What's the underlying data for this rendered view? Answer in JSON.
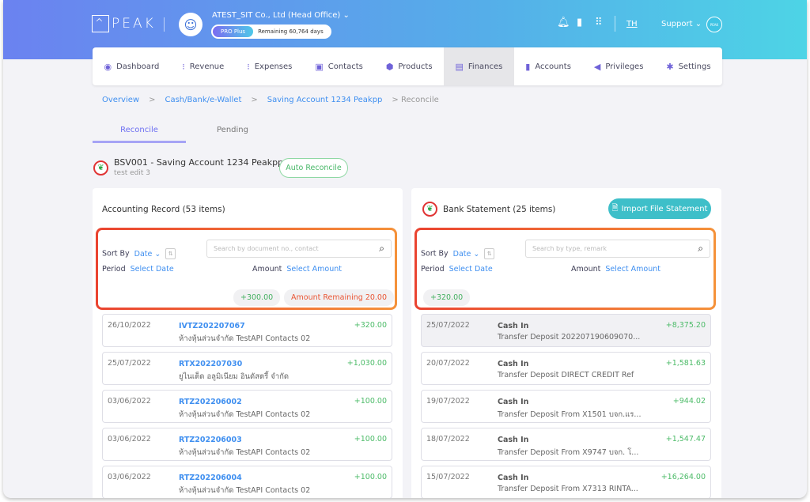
{
  "header": {
    "logo": "PEAK",
    "company": "ATEST_SIT Co., Ltd (Head Office)",
    "plan": "PRO Plus",
    "remaining": "Remaining 60,764 days",
    "lang": "TH",
    "support": "Support",
    "badge": "PEAK"
  },
  "nav": [
    {
      "label": "Dashboard",
      "icon": "◉"
    },
    {
      "label": "Revenue",
      "icon": "⁝"
    },
    {
      "label": "Expenses",
      "icon": "⁝"
    },
    {
      "label": "Contacts",
      "icon": "▣"
    },
    {
      "label": "Products",
      "icon": "⬢"
    },
    {
      "label": "Finances",
      "icon": "▤",
      "active": true
    },
    {
      "label": "Accounts",
      "icon": "▮"
    },
    {
      "label": "Privileges",
      "icon": "◀"
    },
    {
      "label": "Settings",
      "icon": "✱"
    }
  ],
  "breadcrumb": [
    "Overview",
    "Cash/Bank/e-Wallet",
    "Saving Account 1234 Peakpp",
    "Reconcile"
  ],
  "tabs": [
    "Reconcile",
    "Pending"
  ],
  "account": {
    "title": "BSV001 - Saving Account 1234 Peakpp",
    "subtitle": "test edit 3",
    "auto_reconcile": "Auto Reconcile"
  },
  "left": {
    "title": "Accounting Record (53 items)",
    "sort_label": "Sort By",
    "sort_value": "Date",
    "search_placeholder": "Search by document no., contact",
    "period_label": "Period",
    "period_value": "Select Date",
    "amount_label": "Amount",
    "amount_value": "Select Amount",
    "total": "+300.00",
    "remaining": "Amount Remaining 20.00",
    "rows": [
      {
        "date": "26/10/2022",
        "doc": "IVTZ202207067",
        "desc": "ห้างหุ้นส่วนจำกัด TestAPI Contacts 02",
        "amount": "+320.00"
      },
      {
        "date": "25/07/2022",
        "doc": "RTX202207030",
        "desc": "ยูไนเต็ด อลูมิเนียม อินดัสตรี้ จำกัด",
        "amount": "+1,030.00"
      },
      {
        "date": "03/06/2022",
        "doc": "RTZ202206002",
        "desc": "ห้างหุ้นส่วนจำกัด TestAPI Contacts 02",
        "amount": "+100.00"
      },
      {
        "date": "03/06/2022",
        "doc": "RTZ202206003",
        "desc": "ห้างหุ้นส่วนจำกัด TestAPI Contacts 02",
        "amount": "+100.00"
      },
      {
        "date": "03/06/2022",
        "doc": "RTZ202206004",
        "desc": "ห้างหุ้นส่วนจำกัด TestAPI Contacts 02",
        "amount": "+100.00"
      }
    ]
  },
  "right": {
    "title": "Bank Statement (25 items)",
    "import": "Import File Statement",
    "sort_label": "Sort By",
    "sort_value": "Date",
    "search_placeholder": "Search by type, remark",
    "period_label": "Period",
    "period_value": "Select Date",
    "amount_label": "Amount",
    "amount_value": "Select Amount",
    "total": "+320.00",
    "rows": [
      {
        "date": "25/07/2022",
        "type": "Cash In",
        "desc": "Transfer Deposit 202207190609070...",
        "amount": "+8,375.20",
        "selected": true
      },
      {
        "date": "20/07/2022",
        "type": "Cash In",
        "desc": "Transfer Deposit DIRECT CREDIT Ref",
        "amount": "+1,581.63"
      },
      {
        "date": "19/07/2022",
        "type": "Cash In",
        "desc": "Transfer Deposit From X1501 บจก.แร...",
        "amount": "+944.02"
      },
      {
        "date": "18/07/2022",
        "type": "Cash In",
        "desc": "Transfer Deposit From X9747 บจก. โ...",
        "amount": "+1,547.47"
      },
      {
        "date": "15/07/2022",
        "type": "Cash In",
        "desc": "Transfer Deposit From X7313 RINTA...",
        "amount": "+16,264.00"
      }
    ]
  },
  "colors": {
    "accent": "#3f8ff0",
    "positive": "#4cbb68",
    "warning": "#ea5534",
    "highlight_border": "#ea4330"
  }
}
